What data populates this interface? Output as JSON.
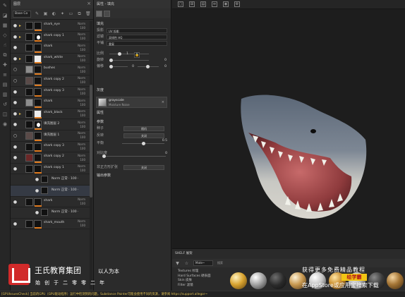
{
  "layers": {
    "title": "图层",
    "blend_mode": "Base Co",
    "rows": [
      {
        "name": "shark_eye",
        "mode": "Norm",
        "opacity": "100",
        "variant": "mask",
        "eye": "●",
        "fold": "▸"
      },
      {
        "name": "shark copy 1",
        "mode": "Norm",
        "opacity": "100",
        "variant": "blob",
        "eye": "●",
        "fold": "▸"
      },
      {
        "name": "shark",
        "mode": "Norm",
        "opacity": "100",
        "variant": "plain",
        "eye": "●",
        "fold": ""
      },
      {
        "name": "shark_white",
        "mode": "Norm",
        "opacity": "100",
        "variant": "white",
        "eye": "●",
        "fold": "▸"
      },
      {
        "name": "bushes",
        "mode": "Norm",
        "opacity": "100",
        "variant": "gray",
        "eye": "○",
        "fold": ""
      },
      {
        "name": "shark copy 2",
        "mode": "Norm",
        "opacity": "100",
        "variant": "dark",
        "eye": "○",
        "fold": ""
      },
      {
        "name": "shark copy 3",
        "mode": "Norm",
        "opacity": "100",
        "variant": "plain",
        "eye": "●",
        "fold": ""
      },
      {
        "name": "shark",
        "mode": "Norm",
        "opacity": "100",
        "variant": "gray",
        "eye": "●",
        "fold": ""
      },
      {
        "name": "shark_black",
        "mode": "Norm",
        "opacity": "100",
        "variant": "white",
        "eye": "●",
        "fold": "▸"
      },
      {
        "name": "填充图层 2",
        "mode": "Norm",
        "opacity": "100",
        "variant": "blob",
        "eye": "●",
        "fold": ""
      },
      {
        "name": "填充图层 1",
        "mode": "Norm",
        "opacity": "100",
        "variant": "dark",
        "eye": "○",
        "fold": ""
      },
      {
        "name": "shark copy 3",
        "mode": "Norm",
        "opacity": "100",
        "variant": "plain",
        "eye": "●",
        "fold": ""
      },
      {
        "name": "shark copy 2",
        "mode": "Norm",
        "opacity": "100",
        "variant": "red",
        "eye": "●",
        "fold": ""
      },
      {
        "name": "shark copy 1",
        "mode": "Norm",
        "opacity": "100",
        "variant": "mask",
        "eye": "●",
        "fold": ""
      },
      {
        "name": "Norm 正常 · 100 ·",
        "mode": "",
        "opacity": "",
        "variant": "sub",
        "eye": "●",
        "fold": ""
      },
      {
        "name": "Norm 正常 · 100 ·",
        "mode": "",
        "opacity": "",
        "variant": "sub",
        "eye": "●",
        "fold": ""
      },
      {
        "name": "shark",
        "mode": "Norm",
        "opacity": "100",
        "variant": "plain",
        "eye": "●",
        "fold": ""
      },
      {
        "name": "Norm 正常 · 100 ·",
        "mode": "",
        "opacity": "",
        "variant": "sub",
        "eye": "●",
        "fold": ""
      },
      {
        "name": "shark_mouth",
        "mode": "Norm",
        "opacity": "100",
        "variant": "plain",
        "eye": "●",
        "fold": ""
      }
    ]
  },
  "properties": {
    "title": "属性 - 填充",
    "section_fill": "填充",
    "projection_label": "投影",
    "projection_value": "UV 投影",
    "filter_label": "滤镜",
    "filter_value": "双线性 HQ",
    "tiling_label": "平铺",
    "tiling_value": "重复",
    "scale_label": "比例",
    "scale_value": "1",
    "rotation_label": "旋转",
    "rotation_value": "0",
    "offset_label": "偏移",
    "offset_x": "0",
    "offset_y": "0",
    "section_gray": "灰度",
    "material_name": "grayscale",
    "material_sub": "Moisture Noise",
    "attributes_label": "属性",
    "params_label": "参数",
    "seed_label": "种子",
    "seed_value": "随机",
    "invert_label": "反转",
    "invert_value": "关闭",
    "balance_label": "平衡",
    "balance_value": "0.5",
    "contrast_label": "对比度",
    "contrast_value": "0",
    "tile_label": "非正方形扩张",
    "tile_value": "关闭",
    "advanced_label": "输出参数"
  },
  "shelf": {
    "title": "SHELF 展架",
    "filter": "Mate~",
    "search_placeholder": "搜索",
    "categories": [
      "Textures 纹理",
      "Hard Surfaces 硬表面",
      "Skin 皮肤",
      "Filter 滤镜"
    ]
  },
  "watermark": {
    "company": "王氏教育集团",
    "motto": "以人为本",
    "year": "始创于二零零二年",
    "line1": "获得更多免费精品教程",
    "badge": "绘学霸",
    "line2": "在AppStore或应用宝搜索下载"
  },
  "status_bar": "[GPUIssuesCheck] 当前的GPU（GPU驱动程序）运行中检测到的问题，Substance Painter可能会使用不同的资源，请参阅 https://support.allegor~"
}
